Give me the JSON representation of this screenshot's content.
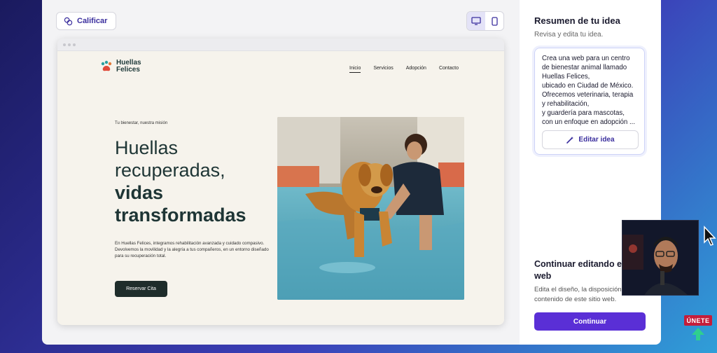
{
  "toolbar": {
    "rate_label": "Calificar",
    "devices": [
      "desktop-icon",
      "mobile-icon"
    ],
    "active_device": "desktop"
  },
  "site": {
    "brand_line1": "Huellas",
    "brand_line2": "Felices",
    "nav": [
      "Inicio",
      "Servicios",
      "Adopción",
      "Contacto"
    ],
    "kicker": "Tu bienestar, nuestra misión",
    "title_light": "Huellas recuperadas,",
    "title_bold": "vidas transformadas",
    "description": "En Huellas Felices, integramos rehabilitación avanzada y cuidado compasivo. Devolvemos la movilidad y la alegría a tus compañeros, en un entorno diseñado para su recuperación total.",
    "cta": "Reservar Cita"
  },
  "panel": {
    "title": "Resumen de tu idea",
    "subtitle": "Revisa y edita tu idea.",
    "idea_text": "Crea una web para un centro de bienestar animal llamado Huellas Felices,\nubicado en Ciudad de México.\nOfrecemos veterinaria, terapia y rehabilitación,\ny guardería para mascotas, con un enfoque en adopción ...",
    "edit_label": "Editar idea",
    "continue_title": "Continuar editando el web",
    "continue_desc_line1": "Edita el diseño, la disposición",
    "continue_desc_line2": "contenido de este sitio web.",
    "continue_label": "Continuar"
  },
  "overlay": {
    "join_label": "ÚNETE"
  },
  "colors": {
    "accent": "#5a2fd6",
    "brand_text": "#3b2f9e",
    "hero_dark": "#1e3535",
    "join_red": "#c41d3a"
  }
}
